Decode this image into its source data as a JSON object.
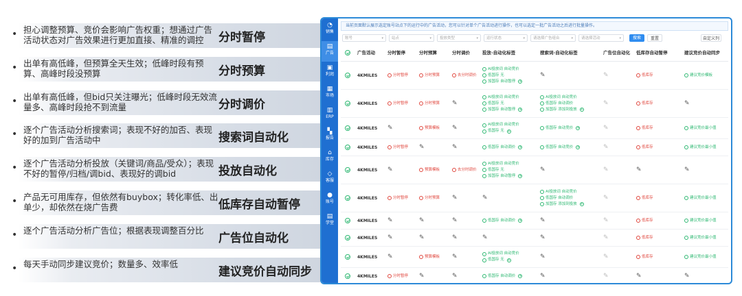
{
  "features": [
    {
      "desc": "担心调整预算、竞价会影响广告权重；想通过广告活动状态对广告效果进行更加直接、精准的调控",
      "name": "分时暂停"
    },
    {
      "desc": "出单有高低峰，但预算全天生效；低峰时段有预算、高峰时段没预算",
      "name": "分时预算"
    },
    {
      "desc": "出单有高低峰，但bid只关注曝光；低峰时段无效流量多、高峰时段抢不到流量",
      "name": "分时调价"
    },
    {
      "desc": "逐个广告活动分析搜索词；表现不好的加否、表现好的加到广告活动中",
      "name": "搜索词自动化"
    },
    {
      "desc": "逐个广告活动分析投放（关键词/商品/受众）；表现不好的暂停/归档/调bid、表现好的调bid",
      "name": "投放自动化"
    },
    {
      "desc": "产品无可用库存，但依然有buybox；转化率低、出单少，却依然在烧广告费",
      "name": "低库存自动暂停"
    },
    {
      "desc": "逐个广告活动分析广告位；根据表现调整百分比",
      "name": "广告位自动化"
    },
    {
      "desc": "每天手动同步建议竞价；数量多、效率低",
      "name": "建议竞价自动同步"
    }
  ],
  "sidebar": [
    {
      "icon": "◔",
      "label": "销售",
      "active": false
    },
    {
      "icon": "▤",
      "label": "广告",
      "active": true
    },
    {
      "icon": "▣",
      "label": "利润",
      "active": false
    },
    {
      "icon": "▦",
      "label": "市场",
      "active": false
    },
    {
      "icon": "▥",
      "label": "ERP",
      "active": false
    },
    {
      "icon": "▚",
      "label": "报告",
      "active": false
    },
    {
      "icon": "⌂",
      "label": "库存",
      "active": false
    },
    {
      "icon": "◇",
      "label": "客服",
      "active": false
    },
    {
      "icon": "●",
      "label": "账号",
      "active": false
    },
    {
      "icon": "▤",
      "label": "学堂",
      "active": false
    }
  ],
  "notice": "当前页面默认展示选定账号站点下的运行中的广告活动，您可以针对单个广告活动进行操作，也可以选定一批广告活动之后进行批量操作。",
  "filters": [
    "账号",
    "站点",
    "投放类型",
    "运行状态",
    "请选择广告组合",
    "请选择活动"
  ],
  "buttons": {
    "search": "搜索",
    "reset": "重置",
    "custom_cols": "自定义列"
  },
  "columns": [
    "广告活动",
    "分时暂停",
    "分时预算",
    "分时调价",
    "投放-自动化标签",
    "搜索词-自动化标签",
    "广告位自动化",
    "低库存自动暂停",
    "建议竞价自动同步"
  ],
  "rows": [
    {
      "campaign": "4KMILES",
      "pause": "分时暂停",
      "budget": "分时预算",
      "bid": "去分时调价",
      "target": [
        [
          "AI投放词",
          "自动竞价"
        ],
        [
          "低国存",
          "无"
        ],
        [
          "加国存",
          "自动暂停"
        ]
      ],
      "search": [],
      "lowstock": "低库存",
      "sync": "建议竞价模板"
    },
    {
      "campaign": "4KMILES",
      "pause": "分时暂停",
      "budget": "分时预算",
      "bid": "",
      "target": [
        [
          "AI投放词",
          "自动竞价"
        ],
        [
          "低国存",
          "无"
        ],
        [
          "加国存",
          "自动暂停"
        ]
      ],
      "search": [
        [
          "AI投放词",
          "自动竞价"
        ],
        [
          "低国存",
          "自动调价"
        ],
        [
          "加国存",
          "添加到投放"
        ]
      ],
      "lowstock": "低库存",
      "sync": ""
    },
    {
      "campaign": "4KMILES",
      "pause": "",
      "budget": "预算模板",
      "bid": "",
      "target": [
        [
          "AI投放词",
          "自动竞价"
        ],
        [
          "低国存",
          "无"
        ]
      ],
      "search": [
        [
          "低国存",
          "自动竞价"
        ]
      ],
      "lowstock": "低库存",
      "sync": "建议竞价最小值"
    },
    {
      "campaign": "4KMILES",
      "pause": "分时暂停",
      "budget": "",
      "bid": "",
      "target": [
        [
          "低国存",
          "自动调价"
        ]
      ],
      "search": [
        [
          "低国存",
          "自动竞价"
        ]
      ],
      "lowstock": "低库存",
      "sync": "建议竞价最小值"
    },
    {
      "campaign": "4KMILES",
      "pause": "",
      "budget": "预算模板",
      "bid": "去分时调价",
      "target": [
        [
          "AI投放词",
          "自动竞价"
        ],
        [
          "低国存",
          "无"
        ],
        [
          "加国存",
          "自动暂停"
        ]
      ],
      "search": [],
      "lowstock": "",
      "sync": ""
    },
    {
      "campaign": "4KMILES",
      "pause": "分时暂停",
      "budget": "分时预算",
      "bid": "",
      "target": [],
      "search": [
        [
          "AI投放词",
          "自动竞价"
        ],
        [
          "低国存",
          "自动调价"
        ],
        [
          "加国存",
          "添加到投放"
        ]
      ],
      "lowstock": "低库存",
      "sync": "建议竞价最小值"
    },
    {
      "campaign": "4KMILES",
      "pause": "",
      "budget": "",
      "bid": "",
      "target": [
        [
          "低国存",
          "自动调价"
        ]
      ],
      "search": [],
      "lowstock": "低库存",
      "sync": "建议竞价最小值"
    },
    {
      "campaign": "4KMILES",
      "pause": "",
      "budget": "",
      "bid": "",
      "target": [],
      "search": [],
      "lowstock": "低库存",
      "sync": "建议竞价最小值"
    },
    {
      "campaign": "4KMILES",
      "pause": "",
      "budget": "预算模板",
      "bid": "",
      "target": [
        [
          "AI投放词",
          "自动竞价"
        ],
        [
          "低国存",
          "无"
        ]
      ],
      "search": [],
      "lowstock": "低库存",
      "sync": "建议竞价最小值"
    },
    {
      "campaign": "4KMILES",
      "pause": "分时暂停",
      "budget": "",
      "bid": "",
      "target": [
        [
          "低国存",
          "自动调价"
        ]
      ],
      "search": [],
      "lowstock": "",
      "sync": ""
    }
  ]
}
